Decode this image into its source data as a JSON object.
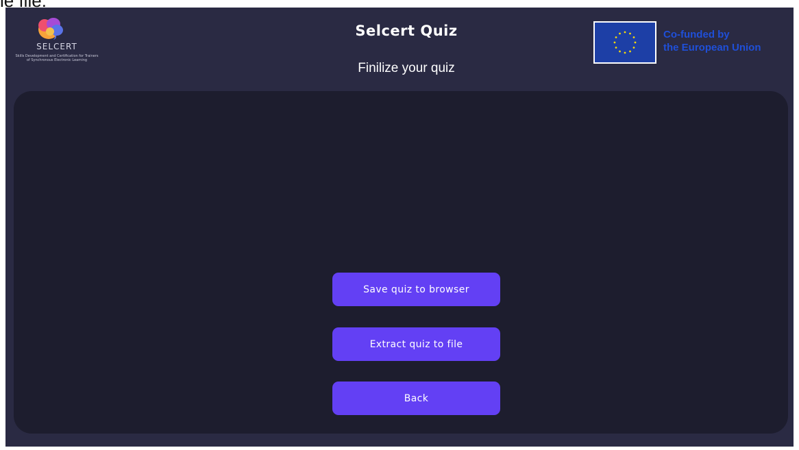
{
  "top_text": "le file.",
  "header": {
    "logo": {
      "name": "SELCERT",
      "tagline": "Skills Development and Certification for Trainers of Synchronous Electronic Learning"
    },
    "title": "Selcert Quiz",
    "subtitle": "Finilize your quiz",
    "eu_label_line1": "Co-funded by",
    "eu_label_line2": "the European Union"
  },
  "actions": {
    "save_label": "Save quiz to browser",
    "extract_label": "Extract quiz to file",
    "back_label": "Back"
  },
  "colors": {
    "frame_bg": "#2a2a43",
    "panel_bg": "#1d1d2e",
    "button_bg": "#6340f4",
    "eu_blue": "#1f4fd8",
    "eu_flag_blue": "#1d3fa6",
    "eu_star_yellow": "#f5d90a"
  },
  "icons": {
    "logo_mark": "brain-logo-icon",
    "eu_flag": "eu-flag-icon"
  }
}
